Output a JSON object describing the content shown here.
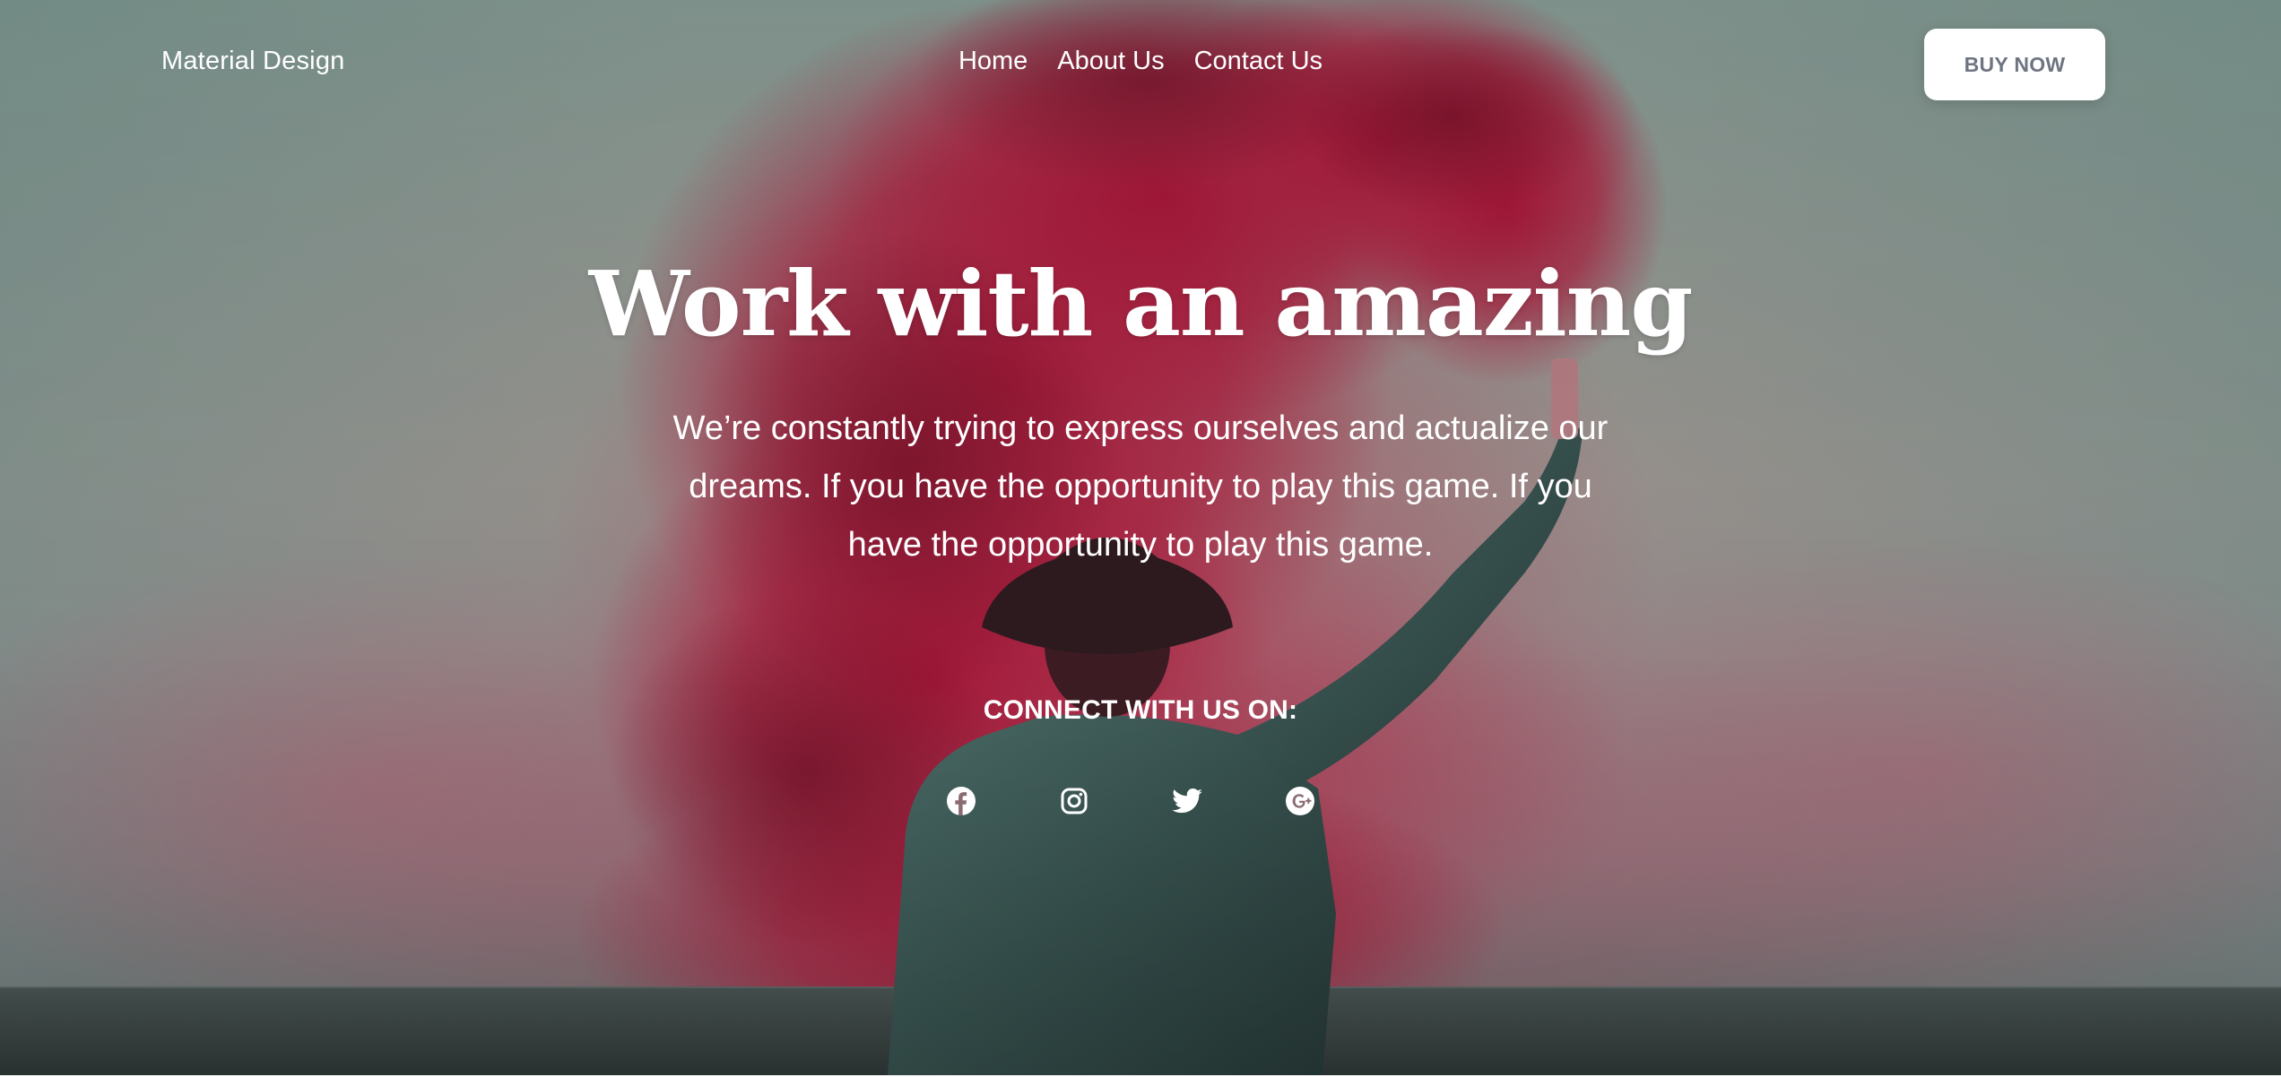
{
  "navbar": {
    "brand": "Material Design",
    "links": [
      "Home",
      "About Us",
      "Contact Us"
    ],
    "cta_label": "BUY NOW"
  },
  "hero": {
    "title": "Work with an amazing",
    "description": "We’re constantly trying to express ourselves and actualize our dreams. If you have the opportunity to play this game. If you have the opportunity to play this game.",
    "connect_label": "CONNECT WITH US ON:",
    "social_icons": [
      "facebook-icon",
      "instagram-icon",
      "twitter-icon",
      "google-plus-icon"
    ]
  },
  "colors": {
    "text": "#ffffff",
    "button_bg": "#ffffff",
    "button_text": "#6f7482",
    "smoke": "#b01a3a",
    "sky": "#8a9893",
    "sea": "#3a4644"
  }
}
